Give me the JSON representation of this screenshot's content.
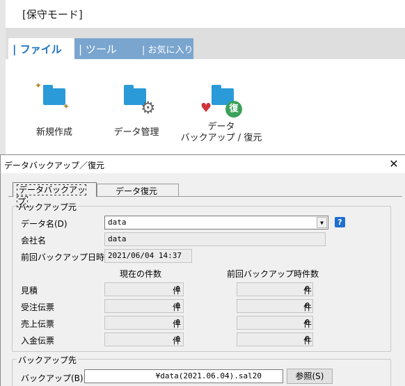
{
  "app": {
    "mode_label": "[保守モード]",
    "ribbon_tabs": [
      "| ファイル",
      "| ツール",
      "| お気に入り"
    ],
    "ribbon_buttons": {
      "new": "新規作成",
      "manage": "データ管理",
      "backup_line1": "データ",
      "backup_line2": "バックアップ / 復元"
    },
    "restore_badge": "復"
  },
  "dialog": {
    "title": "データバックアップ／復元",
    "close_glyph": "✕",
    "tabs": {
      "backup": "データバックアップ",
      "restore": "データ復元"
    },
    "source": {
      "legend": "バックアップ元",
      "data_name_label": "データ名(D)",
      "data_name_value": "data",
      "help_glyph": "?",
      "company_label": "会社名",
      "company_value": "data",
      "last_backup_label": "前回バックアップ日時",
      "last_backup_value": "2021/06/04 14:37",
      "col_current": "現在の件数",
      "col_last": "前回バックアップ時件数",
      "unit": "件",
      "rows": [
        {
          "label": "見積",
          "current": "0",
          "last": "0"
        },
        {
          "label": "受注伝票",
          "current": "0",
          "last": "0"
        },
        {
          "label": "売上伝票",
          "current": "0",
          "last": "0"
        },
        {
          "label": "入金伝票",
          "current": "0",
          "last": "0"
        }
      ]
    },
    "destination": {
      "legend": "バックアップ先",
      "backup_label": "バックアップ(B)",
      "backup_value": "¥data(2021.06.04).sal20",
      "browse_label": "参照(S)"
    }
  },
  "colors": {
    "ribbon_tab_active": "#1e73be",
    "ribbon_tab_inactive": "#7aa5cf",
    "folder": "#2a9ad8",
    "help": "#1e6fd0",
    "restore_badge": "#3aa15a",
    "heart": "#d0343a"
  },
  "icons": [
    "folder-sparkle-icon",
    "folder-gear-icon",
    "folder-heart-restore-icon",
    "help-icon",
    "close-icon",
    "chevron-down-icon"
  ]
}
